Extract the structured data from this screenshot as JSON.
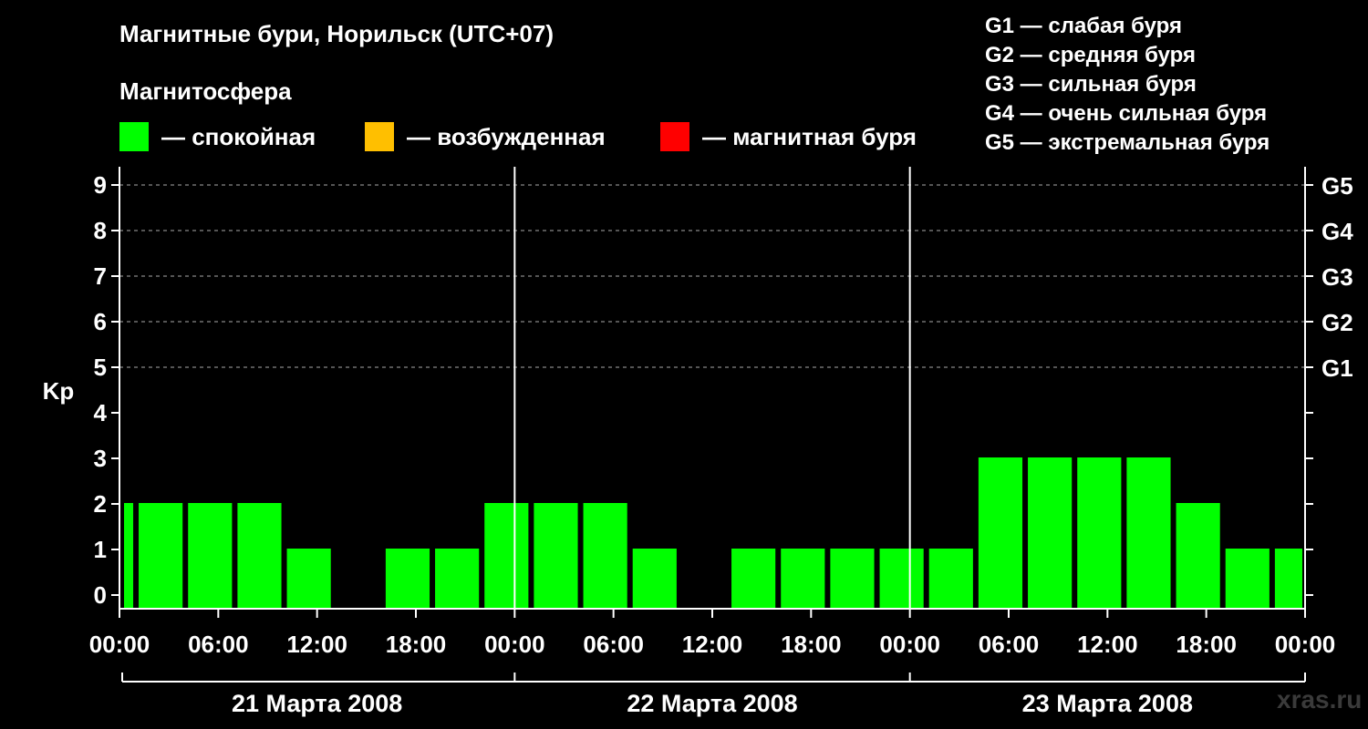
{
  "title": "Магнитные бури, Норильск (UTC+07)",
  "legend": {
    "title": "Магнитосфера",
    "items": [
      {
        "label": "— спокойная",
        "color": "#00ff00"
      },
      {
        "label": "— возбужденная",
        "color": "#ffbf00"
      },
      {
        "label": "— магнитная буря",
        "color": "#ff0000"
      }
    ]
  },
  "storm_scale": [
    "G1 — слабая буря",
    "G2 — средняя буря",
    "G3 — сильная буря",
    "G4 — очень сильная буря",
    "G5 — экстремальная буря"
  ],
  "watermark": "xras.ru",
  "chart_data": {
    "type": "bar",
    "ylabel": "Kp",
    "ylim": [
      -0.3,
      9.4
    ],
    "yticks": [
      0,
      1,
      2,
      3,
      4,
      5,
      6,
      7,
      8,
      9
    ],
    "right_ticks": [
      {
        "value": 5,
        "label": "G1"
      },
      {
        "value": 6,
        "label": "G2"
      },
      {
        "value": 7,
        "label": "G3"
      },
      {
        "value": 8,
        "label": "G4"
      },
      {
        "value": 9,
        "label": "G5"
      }
    ],
    "grid": "dashed at Kp 5–9",
    "x_range_hours": [
      0,
      72
    ],
    "x_tick_labels": [
      "00:00",
      "06:00",
      "12:00",
      "18:00",
      "00:00",
      "06:00",
      "12:00",
      "18:00",
      "00:00",
      "06:00",
      "12:00",
      "18:00",
      "00:00"
    ],
    "day_labels": [
      "21 Марта 2008",
      "22 Марта 2008",
      "23 Марта 2008"
    ],
    "bar_color": "#00ff00",
    "bars": [
      {
        "start": 0,
        "end": 1,
        "kp": 2
      },
      {
        "start": 1,
        "end": 4,
        "kp": 2
      },
      {
        "start": 4,
        "end": 7,
        "kp": 2
      },
      {
        "start": 7,
        "end": 10,
        "kp": 2
      },
      {
        "start": 10,
        "end": 13,
        "kp": 1
      },
      {
        "start": 13,
        "end": 16,
        "kp": 0
      },
      {
        "start": 16,
        "end": 19,
        "kp": 1
      },
      {
        "start": 19,
        "end": 22,
        "kp": 1
      },
      {
        "start": 22,
        "end": 25,
        "kp": 2
      },
      {
        "start": 25,
        "end": 28,
        "kp": 2
      },
      {
        "start": 28,
        "end": 31,
        "kp": 2
      },
      {
        "start": 31,
        "end": 34,
        "kp": 1
      },
      {
        "start": 34,
        "end": 37,
        "kp": 0
      },
      {
        "start": 37,
        "end": 40,
        "kp": 1
      },
      {
        "start": 40,
        "end": 43,
        "kp": 1
      },
      {
        "start": 43,
        "end": 46,
        "kp": 1
      },
      {
        "start": 46,
        "end": 49,
        "kp": 1
      },
      {
        "start": 49,
        "end": 52,
        "kp": 1
      },
      {
        "start": 52,
        "end": 55,
        "kp": 3
      },
      {
        "start": 55,
        "end": 58,
        "kp": 3
      },
      {
        "start": 58,
        "end": 61,
        "kp": 3
      },
      {
        "start": 61,
        "end": 64,
        "kp": 3
      },
      {
        "start": 64,
        "end": 67,
        "kp": 2
      },
      {
        "start": 67,
        "end": 70,
        "kp": 1
      },
      {
        "start": 70,
        "end": 72,
        "kp": 1
      }
    ]
  }
}
